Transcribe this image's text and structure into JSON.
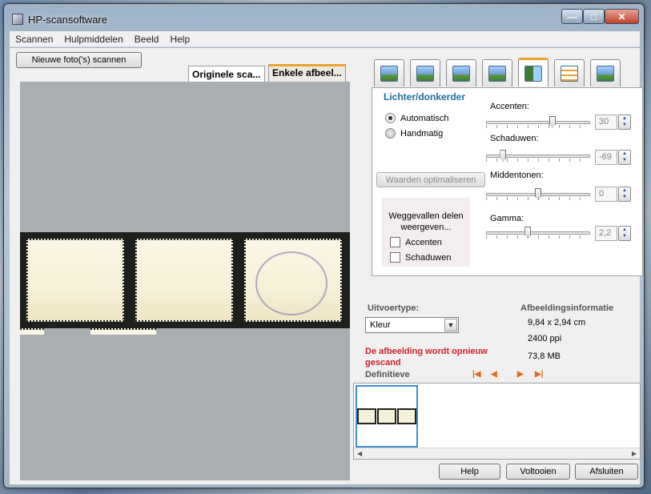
{
  "window": {
    "title": "HP-scansoftware"
  },
  "menu": [
    "Scannen",
    "Hulpmiddelen",
    "Beeld",
    "Help"
  ],
  "scan_button": "Nieuwe foto('s) scannen",
  "preview_tabs": [
    "Originele sca...",
    "Enkele afbeel..."
  ],
  "tool_icons": [
    "preview-tool-icon",
    "color-tool-icon",
    "crop-tool-icon",
    "resize-tool-icon",
    "lighten-darken-tool-icon",
    "adjust-tool-icon",
    "sharpen-tool-icon"
  ],
  "panel": {
    "title": "Lichter/donkerder",
    "radios": [
      {
        "label": "Automatisch",
        "selected": true
      },
      {
        "label": "Handmatig",
        "selected": false
      }
    ],
    "optimize_button": "Waarden optimaliseren",
    "group_label": "Weggevallen delen weergeven...",
    "checkboxes": [
      {
        "label": "Accenten",
        "checked": false
      },
      {
        "label": "Schaduwen",
        "checked": false
      }
    ],
    "sliders": [
      {
        "label": "Accenten:",
        "value": "30",
        "position": 0.64
      },
      {
        "label": "Schaduwen:",
        "value": "-69",
        "position": 0.16
      },
      {
        "label": "Middentonen:",
        "value": "0",
        "position": 0.5
      },
      {
        "label": "Gamma:",
        "value": "2,2",
        "position": 0.4
      }
    ]
  },
  "output": {
    "label": "Uitvoertype:",
    "value": "Kleur"
  },
  "image_info": {
    "title": "Afbeeldingsinformatie",
    "size": "9,84 x 2,94 cm",
    "resolution": "2400 ppi",
    "filesize": "73,8 MB"
  },
  "warning": "De afbeelding wordt opnieuw gescand",
  "final_label": "Definitieve",
  "footer_buttons": [
    "Help",
    "Voltooien",
    "Afsluiten"
  ],
  "colors": {
    "accent": "#f0a030",
    "title_blue": "#1b6d9c",
    "warning_red": "#d0202a"
  }
}
